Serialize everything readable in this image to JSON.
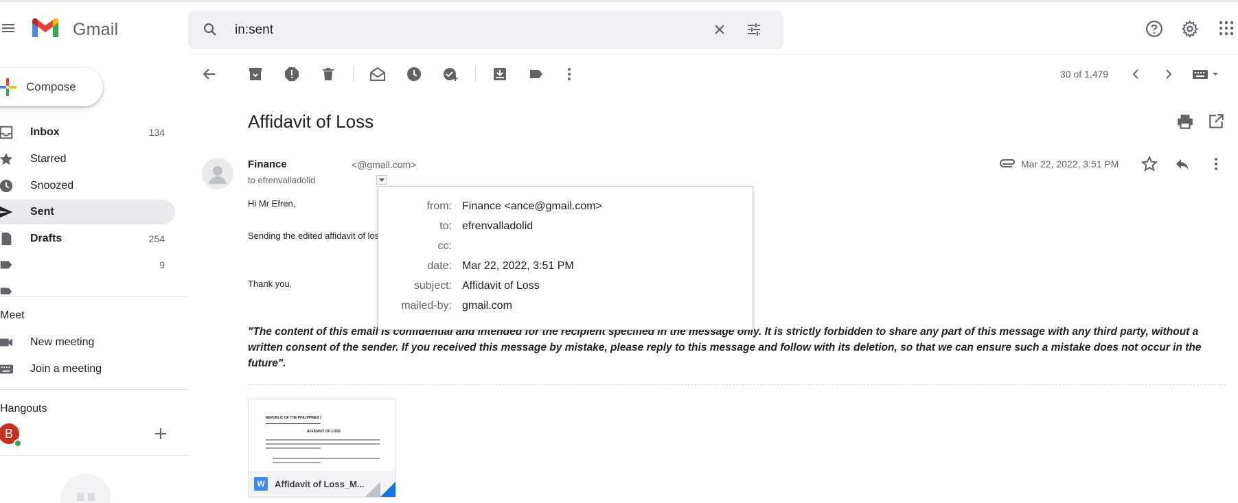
{
  "app": {
    "brand": "Gmail"
  },
  "search": {
    "query": "in:sent"
  },
  "compose": {
    "label": "Compose"
  },
  "nav": [
    {
      "label": "Inbox",
      "count": "134",
      "bold": true
    },
    {
      "label": "Starred",
      "count": ""
    },
    {
      "label": "Snoozed",
      "count": ""
    },
    {
      "label": "Sent",
      "count": "",
      "active": true
    },
    {
      "label": "Drafts",
      "count": "254",
      "bold": true
    },
    {
      "label": "",
      "count": "9"
    }
  ],
  "meet": {
    "title": "Meet",
    "new_meeting": "New meeting",
    "join": "Join a meeting"
  },
  "hangouts": {
    "title": "Hangouts",
    "avatar_letter": "B"
  },
  "toolbar": {
    "pager": "30 of 1,479"
  },
  "email": {
    "subject": "Affidavit of Loss",
    "sender_name": "Finance",
    "sender_email": "<@gmail.com>",
    "to_line": "to efrenvalladolid",
    "date": "Mar 22, 2022, 3:51 PM",
    "greeting": "Hi Mr Efren,",
    "body": "Sending the edited affidavit of loss",
    "closing": "Thank you.",
    "disclaimer": "\"The content of this email is confidential and intended for the recipient specified in the message only. It is strictly forbidden to share any part of this message with any third party, without a written consent of the sender. If you received this message by mistake, please reply to this message and follow with its deletion, so that we can ensure such a mistake does not occur in the future\"."
  },
  "details": [
    {
      "label": "from:",
      "value": "Finance <ance@gmail.com>"
    },
    {
      "label": "to:",
      "value": "efrenvalladolid"
    },
    {
      "label": "cc:",
      "value": ""
    },
    {
      "label": "date:",
      "value": "Mar 22, 2022, 3:51 PM"
    },
    {
      "label": "subject:",
      "value": "Affidavit of Loss"
    },
    {
      "label": "mailed-by:",
      "value": "gmail.com"
    }
  ],
  "attachment": {
    "name": "Affidavit of Loss_M...",
    "type_badge": "W",
    "preview_header": "REPUBLIC OF THE PHILIPPINES )",
    "preview_title": "AFFIDAVIT OF LOSS"
  },
  "colors": {
    "sent_active_bg": "#e8eaed",
    "compose_shadow": "#3c4043",
    "word_blue": "#4285f4"
  }
}
